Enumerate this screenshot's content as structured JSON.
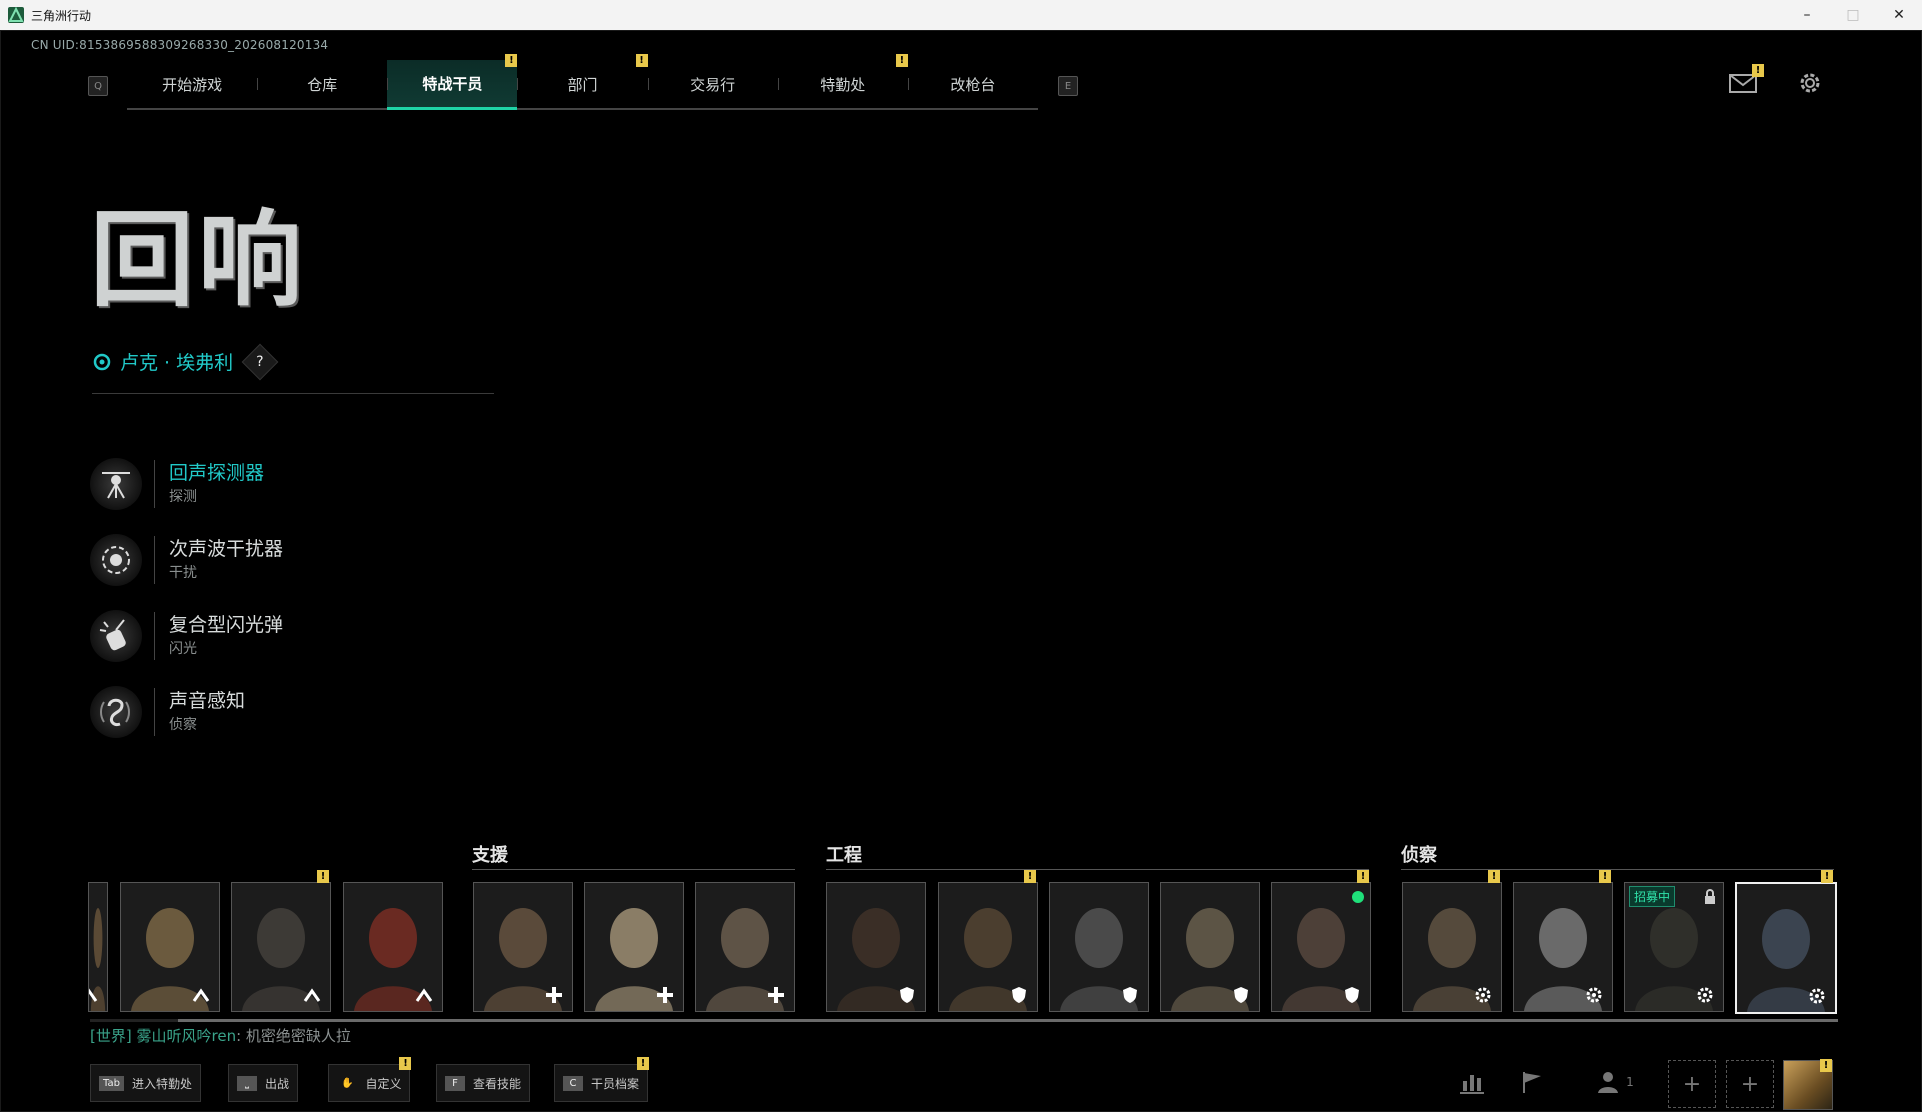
{
  "window": {
    "title": "三角洲行动",
    "minimize": "–",
    "maximize": "□",
    "close": "✕"
  },
  "uid": "CN UID:8153869588309268330_202608120134",
  "nav": {
    "left_key": "Q",
    "right_key": "E",
    "tabs": [
      {
        "label": "开始游戏",
        "alert": false
      },
      {
        "label": "仓库",
        "alert": false
      },
      {
        "label": "特战干员",
        "alert": true,
        "active": true
      },
      {
        "label": "部门",
        "alert": true
      },
      {
        "label": "交易行",
        "alert": false
      },
      {
        "label": "特勤处",
        "alert": true
      },
      {
        "label": "改枪台",
        "alert": false
      }
    ]
  },
  "alert_mark": "!",
  "operator": {
    "title": "回响",
    "name": "卢克 · 埃弗利",
    "help": "?"
  },
  "abilities": [
    {
      "name": "回声探测器",
      "type": "探测",
      "icon": "drone-icon"
    },
    {
      "name": "次声波干扰器",
      "type": "干扰",
      "icon": "disruptor-icon"
    },
    {
      "name": "复合型闪光弹",
      "type": "闪光",
      "icon": "flash-grenade-icon"
    },
    {
      "name": "声音感知",
      "type": "侦察",
      "icon": "ear-icon"
    }
  ],
  "roster": {
    "categories": [
      "支援",
      "工程",
      "侦察"
    ],
    "recruit_label": "招募中"
  },
  "chat": {
    "channel": "[世界]",
    "user": "雾山听风吟ren",
    "message": "机密绝密缺人拉"
  },
  "hints": [
    {
      "key": "Tab",
      "label": "进入特勤处"
    },
    {
      "key": "⎵",
      "label": "出战"
    },
    {
      "key": "✋",
      "label": "自定义"
    },
    {
      "key": "F",
      "label": "查看技能"
    },
    {
      "key": "C",
      "label": "干员档案"
    }
  ],
  "party_count": "1",
  "colors": {
    "accent": "#21c9c8",
    "active_tab": "#1fd4a7",
    "alert": "#e8c84b",
    "background": "#000000"
  }
}
